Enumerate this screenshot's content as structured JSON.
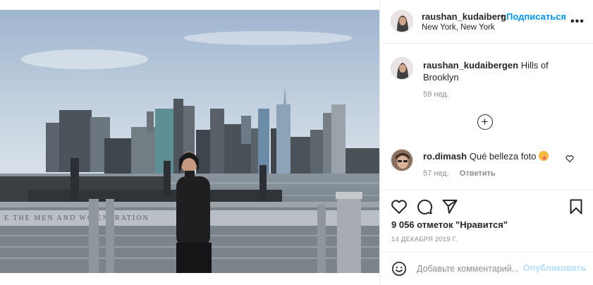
{
  "post": {
    "header": {
      "username": "raushan_kudaiberg",
      "separator": "•",
      "follow_label": "Подписаться",
      "location": "New York, New York",
      "more_icon": "more-horizontal-icon"
    },
    "caption": {
      "username": "raushan_kudaibergen",
      "text": "Hills of Brooklyn",
      "time": "59 нед."
    },
    "load_more_icon": "plus-circle-icon",
    "comments": [
      {
        "username": "ro.dimash",
        "text": "Qué belleza foto",
        "time": "57 нед.",
        "reply_label": "Ответить"
      }
    ],
    "actions": {
      "like_icon": "heart-icon",
      "comment_icon": "comment-icon",
      "share_icon": "paper-plane-icon",
      "save_icon": "bookmark-icon"
    },
    "likes_text": "9 056 отметок \"Нравится\"",
    "date_text": "14 ДЕКАБРЯ 2019 Г.",
    "add_comment": {
      "placeholder": "Добавьте комментарий...",
      "post_label": "Опубликовать",
      "emoji_icon": "smile-icon"
    },
    "photo": {
      "railing_text": "E THE MEN    AND WO    ENERATION"
    },
    "colors": {
      "link_blue": "#0095f6",
      "post_disabled": "#b2dffc",
      "secondary_text": "#8e8e8e",
      "border": "#efefef"
    }
  }
}
